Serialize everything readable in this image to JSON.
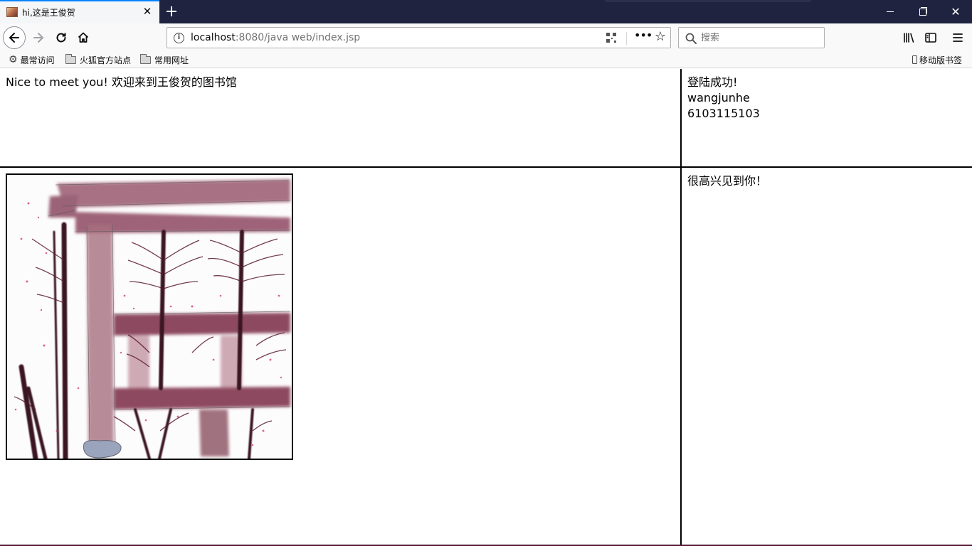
{
  "browser": {
    "tab_title": "hi,这是王俊贺",
    "url_host": "localhost",
    "url_path": ":8080/java web/index.jsp",
    "search_placeholder": "搜索"
  },
  "bookmarks": {
    "most_visited": "最常访问",
    "firefox_official": "火狐官方站点",
    "common_sites": "常用网址",
    "mobile_bookmarks": "移动版书签"
  },
  "page": {
    "welcome": "Nice to meet you! 欢迎来到王俊贺的图书馆",
    "login_status": "登陆成功!",
    "username": "wangjunhe",
    "user_id": "6103115103",
    "greeting": "很高兴见到你！"
  },
  "colors": {
    "tabstrip": "#202340",
    "accent": "#0a84ff",
    "painting_beam": "#7a2a45",
    "painting_branch": "#3a1420",
    "painting_blossom": "#d0306a"
  }
}
